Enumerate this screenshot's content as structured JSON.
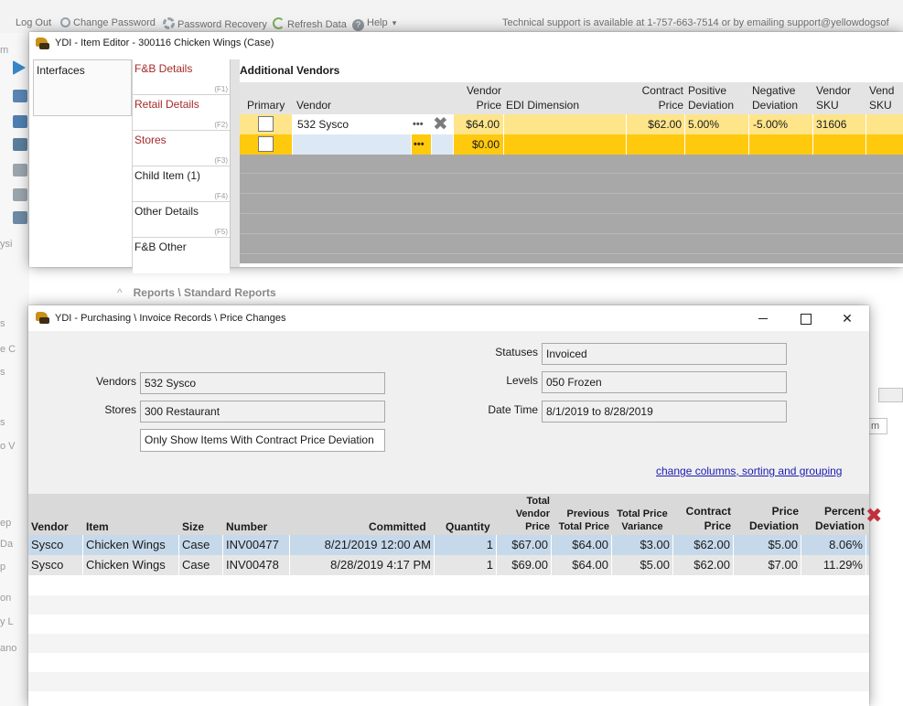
{
  "topbar": {
    "logout": "Log Out",
    "change_password": "Change Password",
    "password_recovery": "Password Recovery",
    "refresh_data": "Refresh Data",
    "help": "Help",
    "help_caret": "▾",
    "support_text": "Technical support is available at 1-757-663-7514 or by emailing support@yellowdogsof"
  },
  "background": {
    "reports_caret": "^",
    "reports_breadcrumb": "Reports \\ Standard Reports",
    "side_fragments": [
      "m",
      "ysi",
      "s",
      "e C",
      "s",
      "s",
      "o V",
      "ep",
      "Da",
      "p",
      "on",
      "y L",
      "ano"
    ],
    "right_input": "m"
  },
  "item_editor": {
    "title": "YDI - Item Editor - 300116 Chicken Wings (Case)",
    "nav_label": "Interfaces",
    "tabs": [
      {
        "label": "F&B Details",
        "key": "(F1)"
      },
      {
        "label": "Retail Details",
        "key": "(F2)"
      },
      {
        "label": "Stores",
        "key": "(F3)"
      },
      {
        "label": "Child Item (1)",
        "key": "(F4)"
      },
      {
        "label": "Other Details",
        "key": "(F5)"
      },
      {
        "label": "F&B Other",
        "key": ""
      }
    ],
    "section_title": "Additional Vendors",
    "columns": {
      "primary": "Primary",
      "vendor": "Vendor",
      "vendor_price_1": "Vendor",
      "vendor_price_2": "Price",
      "edi": "EDI Dimension",
      "contract_1": "Contract",
      "contract_2": "Price",
      "pos_1": "Positive",
      "pos_2": "Deviation",
      "neg_1": "Negative",
      "neg_2": "Deviation",
      "sku_1": "Vendor",
      "sku_2": "SKU",
      "vend_1": "Vend",
      "vend_2": "SKU"
    },
    "rows": [
      {
        "vendor": "532 Sysco",
        "vendor_price": "$64.00",
        "edi": "",
        "contract_price": "$62.00",
        "positive_deviation": "5.00%",
        "negative_deviation": "-5.00%",
        "vendor_sku": "31606"
      },
      {
        "vendor": "",
        "vendor_price": "$0.00",
        "edi": "",
        "contract_price": "",
        "positive_deviation": "",
        "negative_deviation": "",
        "vendor_sku": ""
      }
    ],
    "ellipsis": "•••",
    "delete_glyph": "✖"
  },
  "price_changes": {
    "title": "YDI - Purchasing \\ Invoice Records \\ Price Changes",
    "window_close": "✕",
    "filters": {
      "vendors_label": "Vendors",
      "vendors_value": "532 Sysco",
      "stores_label": "Stores",
      "stores_value": "300 Restaurant",
      "contract_toggle": "Only Show Items With Contract Price Deviation",
      "statuses_label": "Statuses",
      "statuses_value": "Invoiced",
      "levels_label": "Levels",
      "levels_value": "050 Frozen",
      "datetime_label": "Date Time",
      "datetime_value": "8/1/2019 to 8/28/2019"
    },
    "change_columns_link": "change columns, sorting and grouping",
    "columns": {
      "vendor": "Vendor",
      "item": "Item",
      "size": "Size",
      "number": "Number",
      "committed": "Committed",
      "quantity": "Quantity",
      "total_vendor_price_1": "Total",
      "total_vendor_price_2": "Vendor",
      "total_vendor_price_3": "Price",
      "previous_total_price_1": "Previous",
      "previous_total_price_2": "Total Price",
      "total_price_variance_1": "Total Price",
      "total_price_variance_2": "Variance",
      "contract_price_1": "Contract",
      "contract_price_2": "Price",
      "price_deviation_1": "Price",
      "price_deviation_2": "Deviation",
      "percent_deviation_1": "Percent",
      "percent_deviation_2": "Deviation"
    },
    "remove_glyph": "✖",
    "rows": [
      {
        "vendor": "Sysco",
        "item": "Chicken Wings",
        "size": "Case",
        "number": "INV00477",
        "committed": "8/21/2019 12:00 AM",
        "quantity": "1",
        "total_vendor_price": "$67.00",
        "previous_total_price": "$64.00",
        "total_price_variance": "$3.00",
        "contract_price": "$62.00",
        "price_deviation": "$5.00",
        "percent_deviation": "8.06%"
      },
      {
        "vendor": "Sysco",
        "item": "Chicken Wings",
        "size": "Case",
        "number": "INV00478",
        "committed": "8/28/2019 4:17 PM",
        "quantity": "1",
        "total_vendor_price": "$69.00",
        "previous_total_price": "$64.00",
        "total_price_variance": "$5.00",
        "contract_price": "$62.00",
        "price_deviation": "$7.00",
        "percent_deviation": "11.29%"
      }
    ]
  },
  "colors": {
    "row_highlight": "#ffe58a",
    "row_new": "#ffc90e",
    "selected_row": "#c6d9ea",
    "link": "#1a1ab0"
  }
}
